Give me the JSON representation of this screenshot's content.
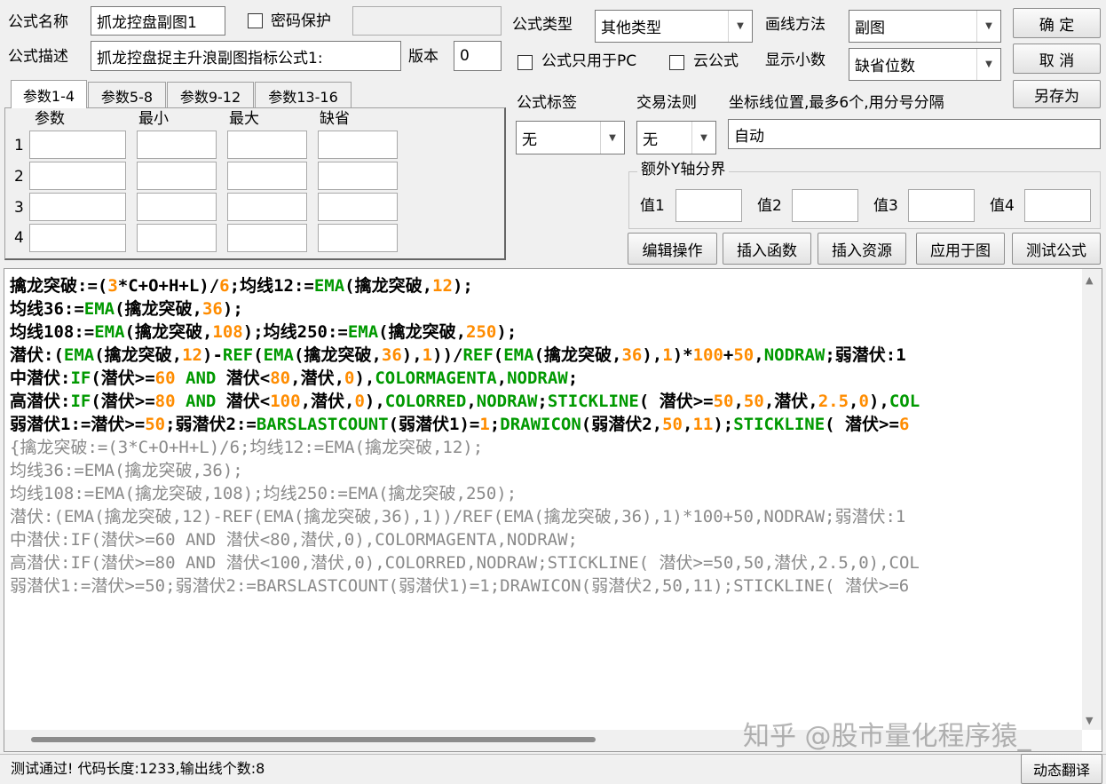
{
  "row1": {
    "name_label": "公式名称",
    "name_value": "抓龙控盘副图1",
    "password_label": "密码保护",
    "type_label": "公式类型",
    "type_value": "其他类型",
    "draw_label": "画线方法",
    "draw_value": "副图",
    "ok_button": "确 定"
  },
  "row2": {
    "desc_label": "公式描述",
    "desc_value": "抓龙控盘捉主升浪副图指标公式1:",
    "version_label": "版本",
    "version_value": "0",
    "pc_only_label": "公式只用于PC",
    "cloud_label": "云公式",
    "decimals_label": "显示小数",
    "decimals_value": "缺省位数",
    "cancel_button": "取 消"
  },
  "saveas_button": "另存为",
  "tabs": [
    "参数1-4",
    "参数5-8",
    "参数9-12",
    "参数13-16"
  ],
  "param_headers": [
    "参数",
    "最小",
    "最大",
    "缺省"
  ],
  "param_rows": [
    "1",
    "2",
    "3",
    "4"
  ],
  "tag": {
    "label": "公式标签",
    "value": "无"
  },
  "trade": {
    "label": "交易法则",
    "value": "无"
  },
  "coord": {
    "label": "坐标线位置,最多6个,用分号分隔",
    "value": "自动"
  },
  "yaxis": {
    "title": "额外Y轴分界",
    "labels": [
      "值1",
      "值2",
      "值3",
      "值4"
    ]
  },
  "actions": [
    "编辑操作",
    "插入函数",
    "插入资源",
    "应用于图",
    "测试公式"
  ],
  "code_active": [
    "擒龙突破:=(3*C+O+H+L)/6;均线12:=EMA(擒龙突破,12);",
    "均线36:=EMA(擒龙突破,36);",
    "均线108:=EMA(擒龙突破,108);均线250:=EMA(擒龙突破,250);",
    "潜伏:(EMA(擒龙突破,12)-REF(EMA(擒龙突破,36),1))/REF(EMA(擒龙突破,36),1)*100+50,NODRAW;弱潜伏:1",
    "中潜伏:IF(潜伏>=60 AND 潜伏<80,潜伏,0),COLORMAGENTA,NODRAW;",
    "高潜伏:IF(潜伏>=80 AND 潜伏<100,潜伏,0),COLORRED,NODRAW;STICKLINE( 潜伏>=50,50,潜伏,2.5,0),COL",
    "弱潜伏1:=潜伏>=50;弱潜伏2:=BARSLASTCOUNT(弱潜伏1)=1;DRAWICON(弱潜伏2,50,11);STICKLINE( 潜伏>=6"
  ],
  "code_comment": [
    "{擒龙突破:=(3*C+O+H+L)/6;均线12:=EMA(擒龙突破,12);",
    "均线36:=EMA(擒龙突破,36);",
    "均线108:=EMA(擒龙突破,108);均线250:=EMA(擒龙突破,250);",
    "潜伏:(EMA(擒龙突破,12)-REF(EMA(擒龙突破,36),1))/REF(EMA(擒龙突破,36),1)*100+50,NODRAW;弱潜伏:1",
    "中潜伏:IF(潜伏>=60 AND 潜伏<80,潜伏,0),COLORMAGENTA,NODRAW;",
    "高潜伏:IF(潜伏>=80 AND 潜伏<100,潜伏,0),COLORRED,NODRAW;STICKLINE( 潜伏>=50,50,潜伏,2.5,0),COL",
    "弱潜伏1:=潜伏>=50;弱潜伏2:=BARSLASTCOUNT(弱潜伏1)=1;DRAWICON(弱潜伏2,50,11);STICKLINE( 潜伏>=6"
  ],
  "watermark": "知乎 @股市量化程序猿_",
  "status_text": "测试通过! 代码长度:1233,输出线个数:8",
  "translate_button": "动态翻译",
  "colors": {
    "function": "#009900",
    "number": "#ff8c00",
    "comment": "#8a8a8a"
  }
}
